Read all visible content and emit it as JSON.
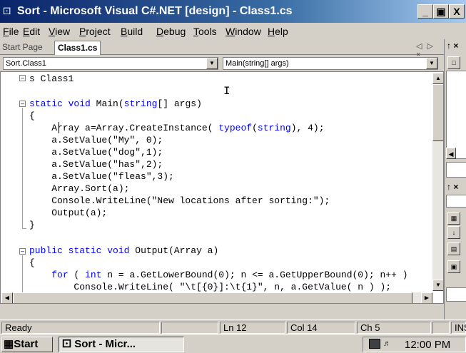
{
  "window": {
    "title": "Sort - Microsoft Visual C#.NET [design] - Class1.cs",
    "icon": "vs-icon",
    "minimize": "_",
    "restore": "×",
    "close": "X"
  },
  "menu": [
    "File",
    "Edit",
    "View",
    "Project",
    "Build",
    "Debug",
    "Tools",
    "Window",
    "Help"
  ],
  "tabs": {
    "start": "Start Page",
    "active": "Class1.cs",
    "nav": "◁ ▷ ×"
  },
  "dropdowns": {
    "class": "Sort.Class1",
    "member": "Main(string[] args)"
  },
  "code": [
    "s Class1",
    "",
    "static void Main(string[] args)",
    "{",
    "    Array a=Array.CreateInstance( typeof(string), 4);",
    "    a.SetValue(\"My\", 0);",
    "    a.SetValue(\"dog\",1);",
    "    a.SetValue(\"has\",2);",
    "    a.SetValue(\"fleas\",3);",
    "    Array.Sort(a);",
    "    Console.WriteLine(\"New locations after sorting:\");",
    "    Output(a);",
    "}",
    "",
    "public static void Output(Array a)",
    "{",
    "",
    "    for ( int n = a.GetLowerBound(0); n <= a.GetUpperBound(0); n++ )",
    "        Console.WriteLine( \"\\t[{0}]:\\t{1}\", n, a.GetValue( n ) );",
    "}"
  ],
  "status": {
    "text": "Ready",
    "line": "Ln 12",
    "col": "Col 14",
    "ch": "Ch 5",
    "mode": "INS"
  },
  "taskbar": {
    "start": "Start",
    "task": "Sort - Micr...",
    "clock": "12:00 PM"
  },
  "right_panel": {
    "pin1": "↑ ×",
    "pin2": "↑ ×"
  }
}
